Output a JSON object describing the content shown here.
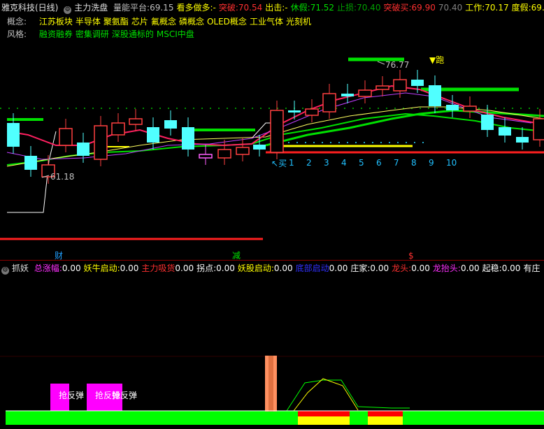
{
  "header": {
    "stock": "雅克科技(日线)",
    "indicator": "主力洗盘",
    "items": [
      {
        "label": "量能平台:",
        "value": "69.15",
        "color": "#c0c0c0"
      },
      {
        "label": "看多做多:",
        "value": "-",
        "color": "#ffff00"
      },
      {
        "label": "突破:",
        "value": "70.54",
        "color": "#ff3030"
      },
      {
        "label": "出击:",
        "value": "-",
        "color": "#ffff00"
      },
      {
        "label": "休假:",
        "value": "71.52",
        "color": "#00e000"
      },
      {
        "label": "止损:",
        "value": "70.40",
        "color": "#00a000"
      },
      {
        "label": "突破买:",
        "value": "69.90",
        "color": "#ff3030"
      },
      {
        "label": "",
        "value": "70.40",
        "color": "#808080"
      },
      {
        "label": "工作:",
        "value": "70.17",
        "color": "#ffff00"
      },
      {
        "label": "度假:",
        "value": "69.",
        "color": "#ffff00"
      }
    ]
  },
  "concept": {
    "label": "概念:",
    "items": [
      "江苏板块",
      "半导体",
      "聚氨酯",
      "芯片",
      "氟概念",
      "磷概念",
      "OLED概念",
      "工业气体",
      "光刻机"
    ]
  },
  "style": {
    "label": "风格:",
    "items": [
      "融资融券",
      "密集调研",
      "深股通标的",
      "MSCI中盘"
    ]
  },
  "main_chart": {
    "high_label": "76.77",
    "low_label": "61.18",
    "run_label": "跑",
    "buy_label": "买",
    "counts": [
      "1",
      "2",
      "3",
      "4",
      "5",
      "6",
      "7",
      "8",
      "9",
      "10"
    ],
    "markers": {
      "cai": "财",
      "jian": "减",
      "s": "$"
    }
  },
  "indicator_header": {
    "name": "抓妖",
    "items": [
      {
        "label": "总涨幅:",
        "value": "0.00",
        "color": "#ff30ff"
      },
      {
        "label": "妖牛启动:",
        "value": "0.00",
        "color": "#ffff00"
      },
      {
        "label": "主力吸货",
        "value": "0.00",
        "color": "#ff3030"
      },
      {
        "label": "拐点:",
        "value": "0.00",
        "color": "#ffffff"
      },
      {
        "label": "妖股启动:",
        "value": "0.00",
        "color": "#ffff00"
      },
      {
        "label": "底部启动",
        "value": "0.00",
        "color": "#3030ff"
      },
      {
        "label": "庄家:",
        "value": "0.00",
        "color": "#ffffff"
      },
      {
        "label": "龙头:",
        "value": "0.00",
        "color": "#ff3030"
      },
      {
        "label": "龙抬头:",
        "value": "0.00",
        "color": "#ff30ff"
      },
      {
        "label": "起稳:",
        "value": "0.00",
        "color": "#ffffff"
      },
      {
        "label": "有庄",
        "value": "",
        "color": "#ffffff"
      }
    ]
  },
  "indicator_chart": {
    "rebound_labels": [
      "抢反弹",
      "抢反弹",
      "抢反弹"
    ]
  }
}
